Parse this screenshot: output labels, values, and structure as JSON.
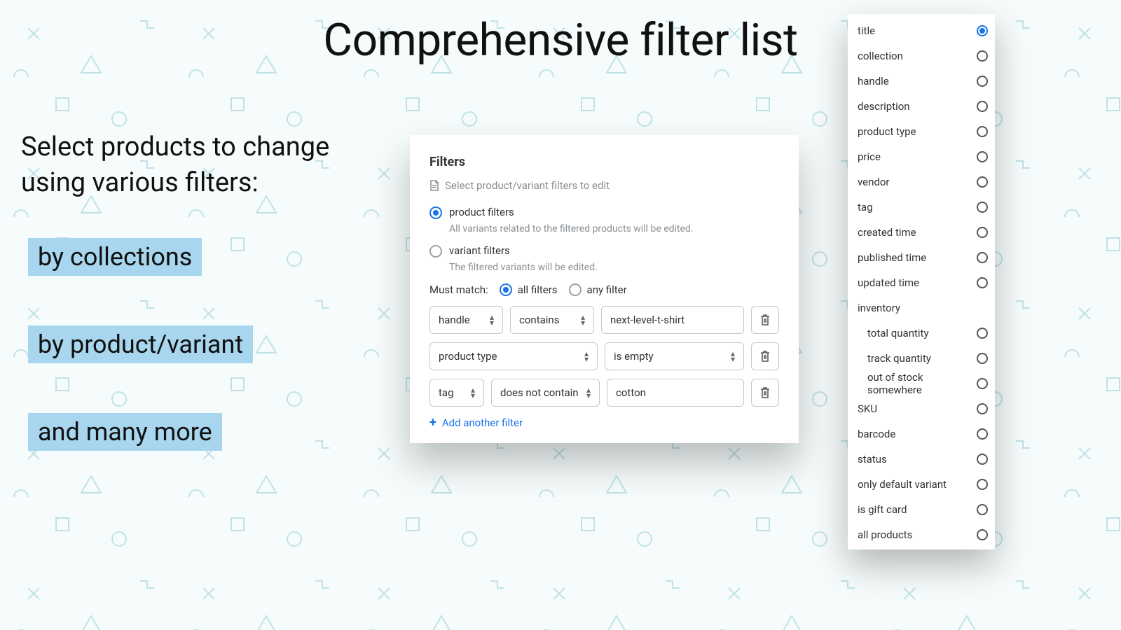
{
  "page": {
    "title": "Comprehensive filter list",
    "subtitle": "Select products to change using various filters:",
    "pills": [
      "by collections",
      "by product/variant",
      "and many more"
    ]
  },
  "filters_panel": {
    "heading": "Filters",
    "hint": "Select product/variant filters to edit",
    "scope": {
      "product": {
        "label": "product filters",
        "description": "All variants related to the filtered products will be edited.",
        "checked": true
      },
      "variant": {
        "label": "variant filters",
        "description": "The filtered variants will be edited.",
        "checked": false
      }
    },
    "match": {
      "label": "Must match:",
      "all": "all filters",
      "any": "any filter",
      "selected": "all"
    },
    "rules": [
      {
        "field": "handle",
        "operator": "contains",
        "value": "next-level-t-shirt"
      },
      {
        "field": "product type",
        "operator": "is empty",
        "value": ""
      },
      {
        "field": "tag",
        "operator": "does not contain",
        "value": "cotton"
      }
    ],
    "add_label": "Add another filter"
  },
  "filter_list": {
    "items": [
      {
        "label": "title",
        "selected": true
      },
      {
        "label": "collection"
      },
      {
        "label": "handle"
      },
      {
        "label": "description"
      },
      {
        "label": "product type"
      },
      {
        "label": "price"
      },
      {
        "label": "vendor"
      },
      {
        "label": "tag"
      },
      {
        "label": "created time"
      },
      {
        "label": "published time"
      },
      {
        "label": "updated time"
      },
      {
        "label": "inventory",
        "noradio": true
      },
      {
        "label": "total quantity",
        "indent": true
      },
      {
        "label": "track quantity",
        "indent": true
      },
      {
        "label": "out of stock somewhere",
        "indent": true
      },
      {
        "label": "SKU"
      },
      {
        "label": "barcode"
      },
      {
        "label": "status"
      },
      {
        "label": "only default variant"
      },
      {
        "label": "is gift card"
      },
      {
        "label": "all products"
      }
    ]
  }
}
